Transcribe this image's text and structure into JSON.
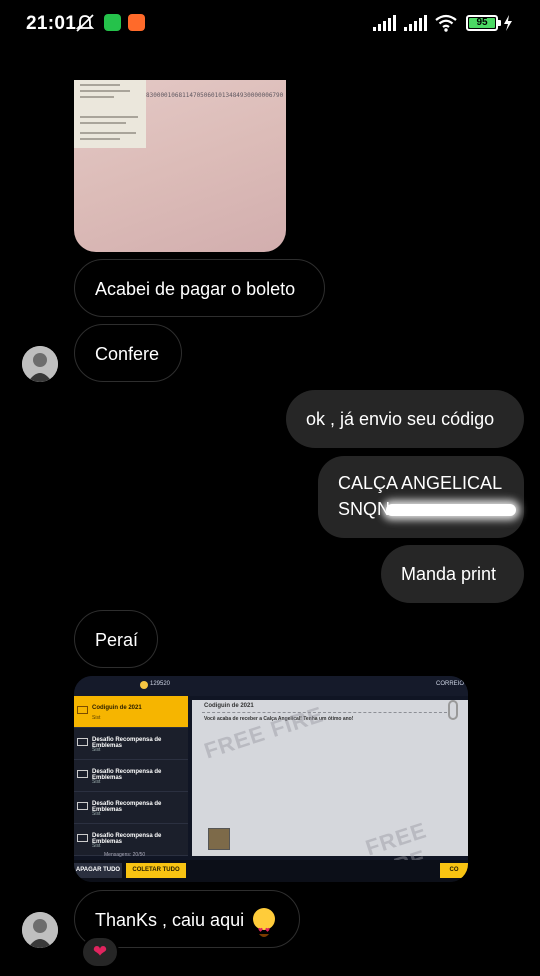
{
  "status_bar": {
    "time": "21:01",
    "battery_level": "95",
    "icons": [
      "silent-icon",
      "whatsapp-icon",
      "record-icon",
      "signal-icon",
      "signal-icon",
      "wifi-icon",
      "battery-icon",
      "charging-icon"
    ]
  },
  "chat": {
    "photo_caption_code": "83000010681147050601013484930000006790",
    "msg1": "Acabei de pagar o boleto",
    "msg2": "Confere",
    "msg3": "ok , já envio seu código",
    "msg4_line1": "CALÇA ANGELICAL",
    "msg4_line2": "SNQN",
    "msg5": "Manda print",
    "msg6": "Peraí",
    "msg7": "ThanKs , caiu aqui",
    "msg7_emoji": "heart-eyes-emoji",
    "reaction": "❤"
  },
  "game": {
    "coins": "129520",
    "mail_label": "CORREIO",
    "selected_item": "Codiguin de 2021",
    "selected_sub": "Sist",
    "items": [
      {
        "title": "Desafio Recompensa de Emblemas",
        "sub": "Sist"
      },
      {
        "title": "Desafio Recompensa de Emblemas",
        "sub": "Sist"
      },
      {
        "title": "Desafio Recompensa de Emblemas",
        "sub": "Sist"
      },
      {
        "title": "Desafio Recompensa de Emblemas",
        "sub": "Sist"
      }
    ],
    "panel_title": "Codiguin de 2021",
    "panel_body": "Você acaba de receber a Calça Angelical! Tenha um ótimo ano!",
    "messages_count": "Mensagens: 20/50",
    "btn_delete": "APAGAR TUDO",
    "btn_collect": "COLETAR TUDO",
    "btn_right": "CO",
    "watermark": "FREE FIRE"
  },
  "colors": {
    "background": "#000000",
    "incoming_border": "#2e2e2e",
    "outgoing_bg": "#262626",
    "game_yellow": "#f8c312"
  }
}
